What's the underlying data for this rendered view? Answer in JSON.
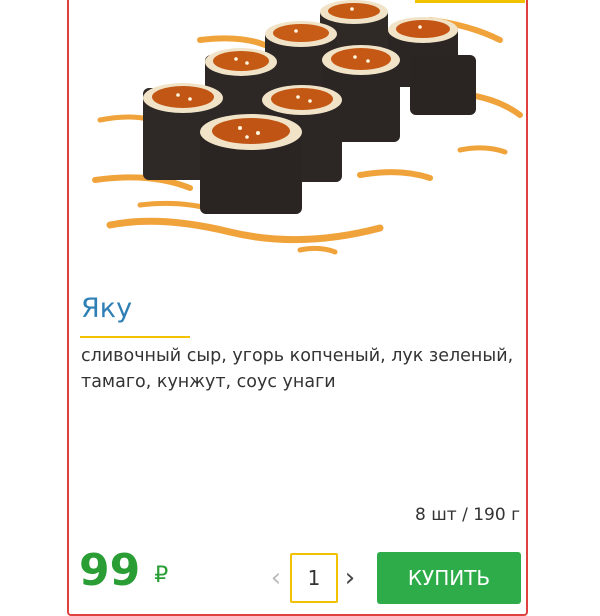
{
  "product": {
    "image_alt": "sushi-roll-photo",
    "title": "Яку",
    "description": "сливочный сыр, угорь копченый, лук зеленый, тамаго, кунжут, соус унаги",
    "portion": "8 шт / 190 г",
    "price": "99",
    "currency": "₽"
  },
  "cart": {
    "quantity": "1",
    "decrement_icon": "chevron-left-icon",
    "increment_icon": "chevron-right-icon",
    "buy_label": "КУПИТЬ"
  },
  "colors": {
    "border": "#e0413f",
    "accent": "#f2c200",
    "title": "#2d7fb6",
    "price": "#2a9d35",
    "button": "#2eac4a"
  }
}
